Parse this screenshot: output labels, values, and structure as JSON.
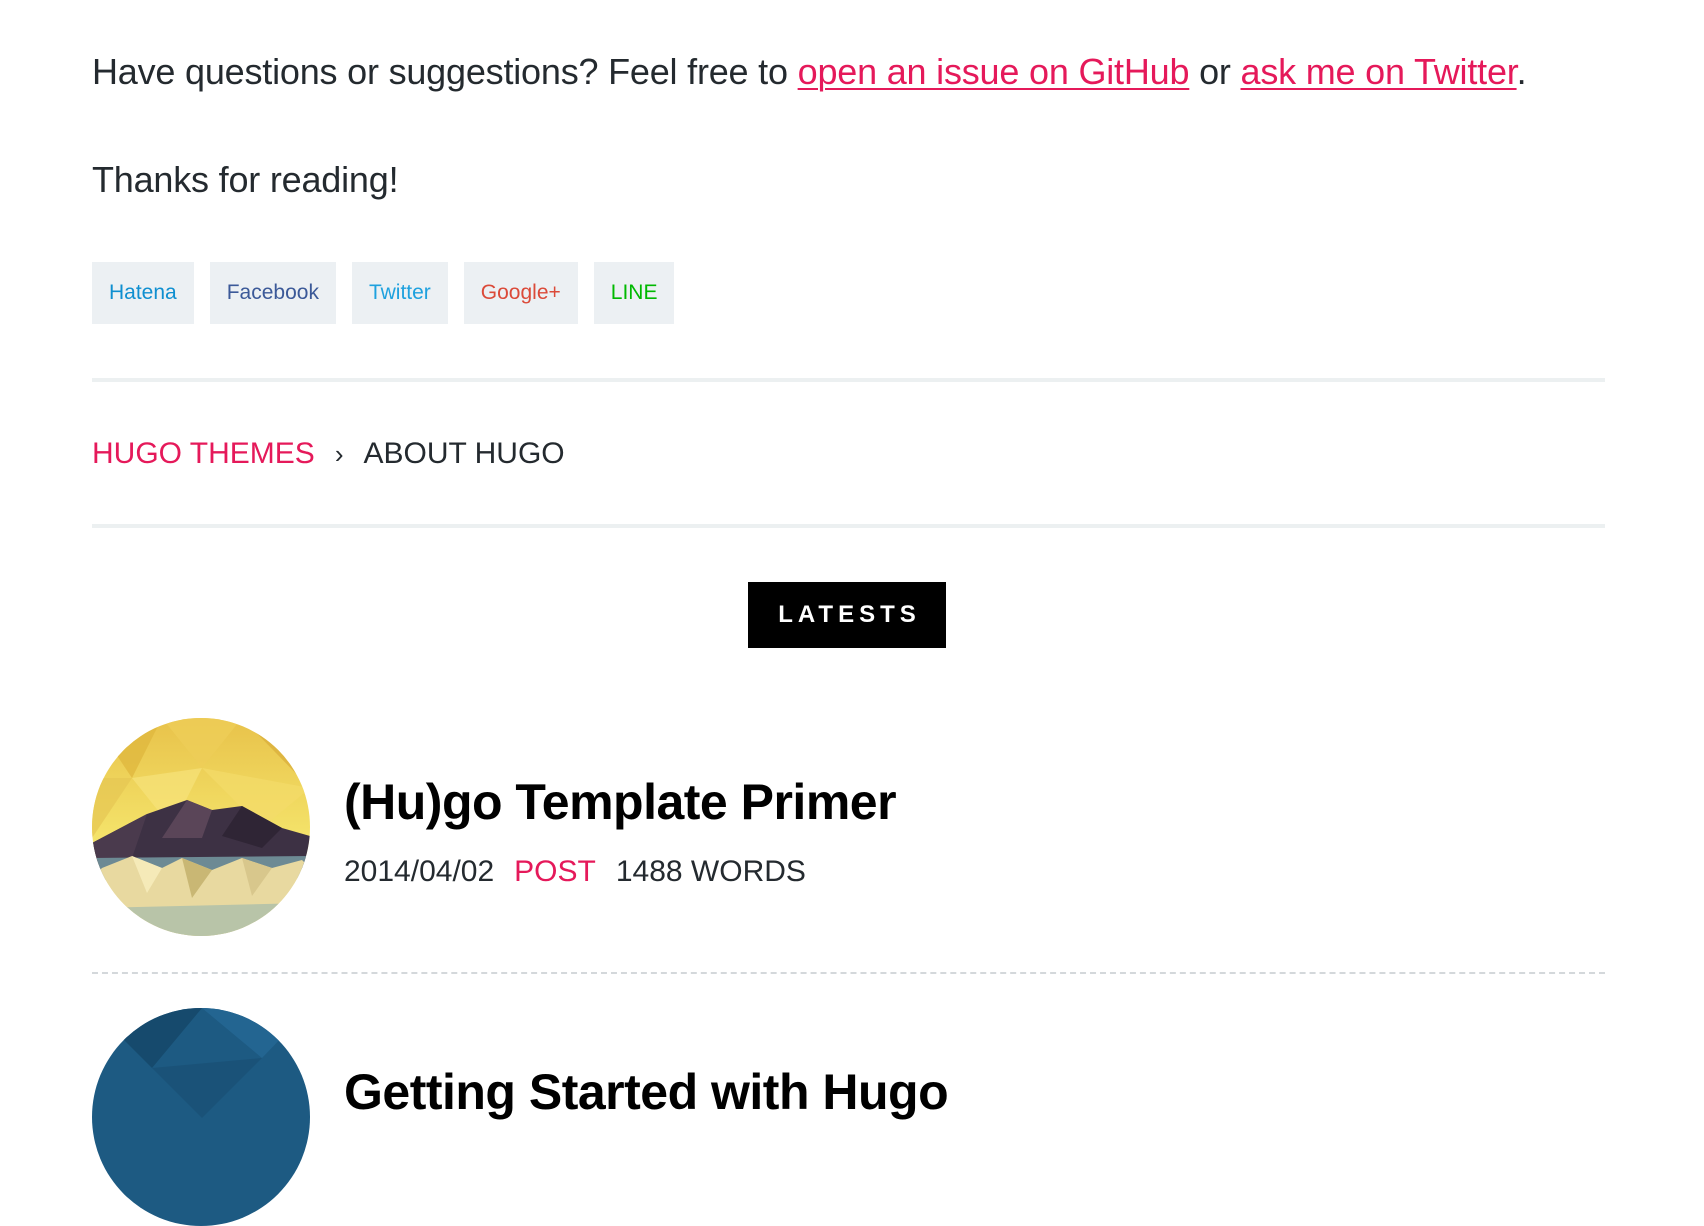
{
  "content": {
    "questions": {
      "text_before": "Have questions or suggestions? Feel free to ",
      "link1_text": "open an issue on GitHub",
      "text_middle": " or ",
      "link2_text": "ask me on Twitter",
      "text_after": "."
    },
    "thanks": "Thanks for reading!"
  },
  "share": {
    "buttons": [
      {
        "label": "Hatena",
        "color": "#0f8fd0"
      },
      {
        "label": "Facebook",
        "color": "#3b5998"
      },
      {
        "label": "Twitter",
        "color": "#1ea1de"
      },
      {
        "label": "Google+",
        "color": "#db4a39"
      },
      {
        "label": "LINE",
        "color": "#00b900"
      }
    ]
  },
  "breadcrumb": {
    "parent": "HUGO THEMES",
    "separator": "›",
    "current": "ABOUT HUGO"
  },
  "latests": {
    "label": "LATESTS"
  },
  "posts": [
    {
      "title": "(Hu)go Template Primer",
      "date": "2014/04/02",
      "category": "POST",
      "words": "1488 WORDS"
    },
    {
      "title": "Getting Started with Hugo"
    }
  ],
  "colors": {
    "accent": "#e5195a",
    "text": "#242a2f",
    "share_bg": "#ecf0f3"
  }
}
